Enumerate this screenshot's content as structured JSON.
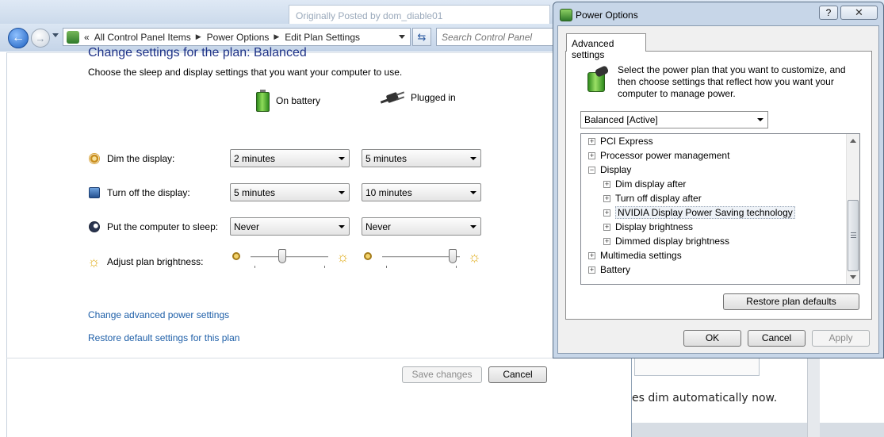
{
  "background": {
    "forum_snippet": "Originally Posted by dom_diable01",
    "right_text": "es dim automatically now."
  },
  "control_panel": {
    "breadcrumb": [
      "«",
      "All Control Panel Items",
      "Power Options",
      "Edit Plan Settings"
    ],
    "search_placeholder": "Search Control Panel",
    "title": "Change settings for the plan: Balanced",
    "subtitle": "Choose the sleep and display settings that you want your computer to use.",
    "columns": {
      "battery": "On battery",
      "plugged": "Plugged in"
    },
    "rows": [
      {
        "label": "Dim the display:",
        "battery": "2 minutes",
        "plugged": "5 minutes"
      },
      {
        "label": "Turn off the display:",
        "battery": "5 minutes",
        "plugged": "10 minutes"
      },
      {
        "label": "Put the computer to sleep:",
        "battery": "Never",
        "plugged": "Never"
      }
    ],
    "brightness": {
      "label": "Adjust plan brightness:",
      "battery_level": 0.4,
      "plugged_level": 0.95
    },
    "links": {
      "advanced": "Change advanced power settings",
      "restore": "Restore default settings for this plan"
    },
    "buttons": {
      "save": "Save changes",
      "cancel": "Cancel"
    }
  },
  "dialog": {
    "title": "Power Options",
    "help": "?",
    "close": "✕",
    "tab": "Advanced settings",
    "intro": "Select the power plan that you want to customize, and then choose settings that reflect how you want your computer to manage power.",
    "plan": "Balanced [Active]",
    "tree": [
      {
        "label": "PCI Express",
        "level": 0,
        "expander": "+"
      },
      {
        "label": "Processor power management",
        "level": 0,
        "expander": "+"
      },
      {
        "label": "Display",
        "level": 0,
        "expander": "−"
      },
      {
        "label": "Dim display after",
        "level": 1,
        "expander": "+"
      },
      {
        "label": "Turn off display after",
        "level": 1,
        "expander": "+"
      },
      {
        "label": "NVIDIA Display Power Saving technology",
        "level": 1,
        "expander": "+",
        "selected": true
      },
      {
        "label": "Display brightness",
        "level": 1,
        "expander": "+"
      },
      {
        "label": "Dimmed display brightness",
        "level": 1,
        "expander": "+"
      },
      {
        "label": "Multimedia settings",
        "level": 0,
        "expander": "+"
      },
      {
        "label": "Battery",
        "level": 0,
        "expander": "+"
      }
    ],
    "buttons": {
      "restore": "Restore plan defaults",
      "ok": "OK",
      "cancel": "Cancel",
      "apply": "Apply"
    }
  }
}
